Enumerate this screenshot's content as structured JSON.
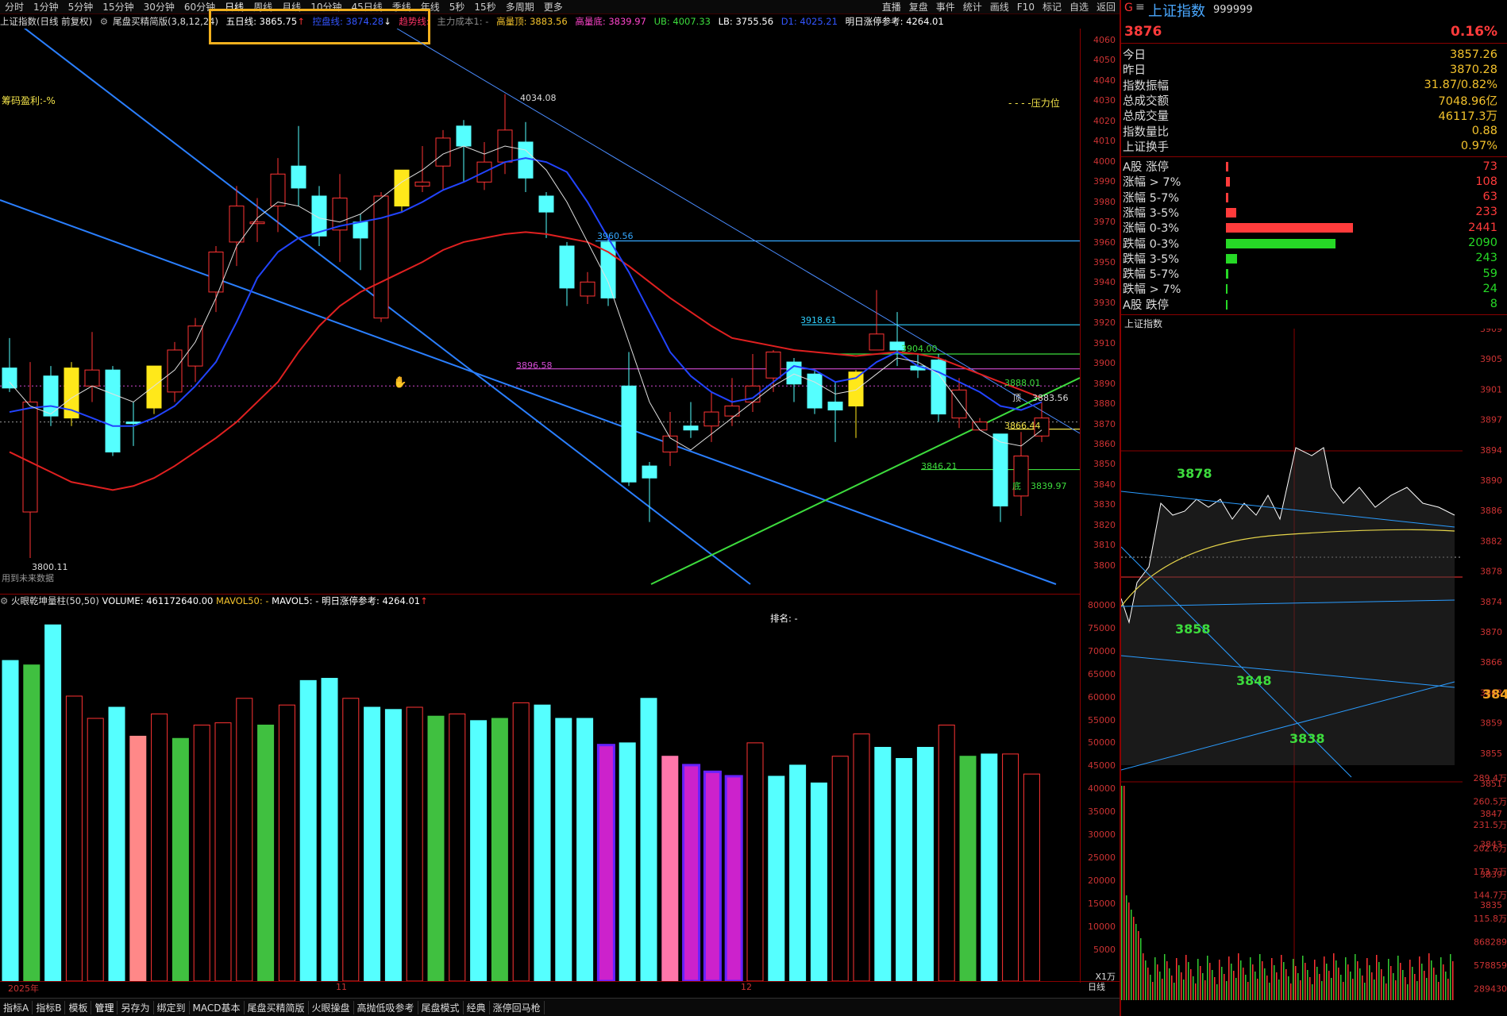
{
  "period_bar": {
    "items": [
      "分时",
      "1分钟",
      "5分钟",
      "15分钟",
      "30分钟",
      "60分钟",
      "日线",
      "周线",
      "月线",
      "10分钟",
      "45日线",
      "季线",
      "年线",
      "5秒",
      "15秒",
      "多周期",
      "更多"
    ],
    "selected": "日线"
  },
  "right_tools": [
    "直播",
    "复盘",
    "事件",
    "统计",
    "画线",
    "F10",
    "标记",
    "自选",
    "返回"
  ],
  "info_line": {
    "title": "上证指数(日线 前复权)",
    "indicator": "尾盘买精简版(3,8,12,24)",
    "wuri": "五日线: 3865.75",
    "kongpan": "控盘线: 3874.28",
    "qushi": "趋势线:",
    "zhuli": "主力成本1: -",
    "gaoliang_ding": "高量顶: 3883.56",
    "gaoliang_di": "高量底: 3839.97",
    "ub": "UB: 4007.33",
    "lb": "LB: 3755.56",
    "d1": "D1: 4025.21",
    "ref": "明日涨停参考: 4264.01"
  },
  "chart_annotations": {
    "chip_profit": "筹码盈利:-%",
    "pressure": "- - - -压力位",
    "note_future": "用到未来数据",
    "high_label": "4034.08",
    "low_label": "3800.11",
    "l3960": "3960.56",
    "l3918": "3918.61",
    "l3904": "3904.00",
    "l3896": "3896.58",
    "l3888": "3888.01",
    "ding": "顶",
    "ding_val": "3883.56",
    "l3866": "3866.44",
    "l3846": "3846.21",
    "di": "底",
    "di_val": "3839.97"
  },
  "price_ticks": [
    "4060",
    "4050",
    "4040",
    "4030",
    "4020",
    "4010",
    "4000",
    "3990",
    "3980",
    "3970",
    "3960",
    "3950",
    "3940",
    "3930",
    "3920",
    "3910",
    "3900",
    "3890",
    "3880",
    "3870",
    "3860",
    "3850",
    "3840",
    "3830",
    "3820",
    "3810",
    "3800"
  ],
  "vol_header": {
    "name": "火眼乾坤量柱(50,50)",
    "volume": "VOLUME: 461172640.00",
    "mavol50": "MAVOL50: -",
    "mavol5": "MAVOL5: -",
    "ref": "明日涨停参考: 4264.01",
    "rank": "排名: -"
  },
  "vol_ticks": [
    "80000",
    "75000",
    "70000",
    "65000",
    "60000",
    "55000",
    "50000",
    "45000",
    "40000",
    "35000",
    "30000",
    "25000",
    "20000",
    "15000",
    "10000",
    "5000"
  ],
  "vol_unit": "X1万",
  "date_axis": {
    "year": "2025年",
    "m11": "11",
    "m12": "12",
    "period": "日线"
  },
  "bottom_tabs": [
    "指标A",
    "指标B",
    "模板",
    "管理",
    "另存为",
    "绑定到",
    "MACD基本",
    "尾盘买精简版",
    "火眼操盘",
    "高抛低吸参考",
    "尾盘模式",
    "经典",
    "涨停回马枪"
  ],
  "right_panel": {
    "code_prefix": "G",
    "title": "上证指数",
    "code": "999999",
    "price": "3876",
    "change": "0.16%",
    "rows": [
      {
        "label": "今日",
        "value": "3857.26"
      },
      {
        "label": "昨日",
        "value": "3870.28"
      },
      {
        "label": "指数振幅",
        "value": "31.87/0.82%"
      },
      {
        "label": "总成交额",
        "value": "7048.96亿"
      },
      {
        "label": "总成交量",
        "value": "46117.3万"
      },
      {
        "label": "指数量比",
        "value": "0.88"
      },
      {
        "label": "上证换手",
        "value": "0.97%"
      }
    ],
    "dist": [
      {
        "label": "A股 涨停",
        "value": "73",
        "color": "#ff3b3b",
        "frac": 0.02
      },
      {
        "label": "涨幅 > 7%",
        "value": "108",
        "color": "#ff3b3b",
        "frac": 0.03
      },
      {
        "label": "涨幅 5-7%",
        "value": "63",
        "color": "#ff3b3b",
        "frac": 0.02
      },
      {
        "label": "涨幅 3-5%",
        "value": "233",
        "color": "#ff3b3b",
        "frac": 0.08
      },
      {
        "label": "涨幅 0-3%",
        "value": "2441",
        "color": "#ff3b3b",
        "frac": 1.0
      },
      {
        "label": "跌幅 0-3%",
        "value": "2090",
        "color": "#26d926",
        "frac": 0.86
      },
      {
        "label": "跌幅 3-5%",
        "value": "243",
        "color": "#26d926",
        "frac": 0.09
      },
      {
        "label": "跌幅 5-7%",
        "value": "59",
        "color": "#26d926",
        "frac": 0.02
      },
      {
        "label": "跌幅 > 7%",
        "value": "24",
        "color": "#26d926",
        "frac": 0.01
      },
      {
        "label": "A股 跌停",
        "value": "8",
        "color": "#26d926",
        "frac": 0.005
      }
    ],
    "mini_title": "上证指数",
    "mini_ticks": [
      "3909",
      "3905",
      "3901",
      "3897",
      "3894",
      "3890",
      "3886",
      "3882",
      "3878",
      "3874",
      "3870",
      "3866",
      "3863",
      "3859",
      "3855",
      "3851",
      "3847",
      "3843",
      "3839",
      "3835"
    ],
    "mini_vol_ticks": [
      "289.4万",
      "260.5万",
      "231.5万",
      "202.6万",
      "173.7万",
      "144.7万",
      "115.8万",
      "868289",
      "578859",
      "289430"
    ],
    "mini_labels": {
      "a": "3878",
      "b": "3858",
      "c": "3848",
      "d": "3838",
      "e": "384"
    }
  }
}
